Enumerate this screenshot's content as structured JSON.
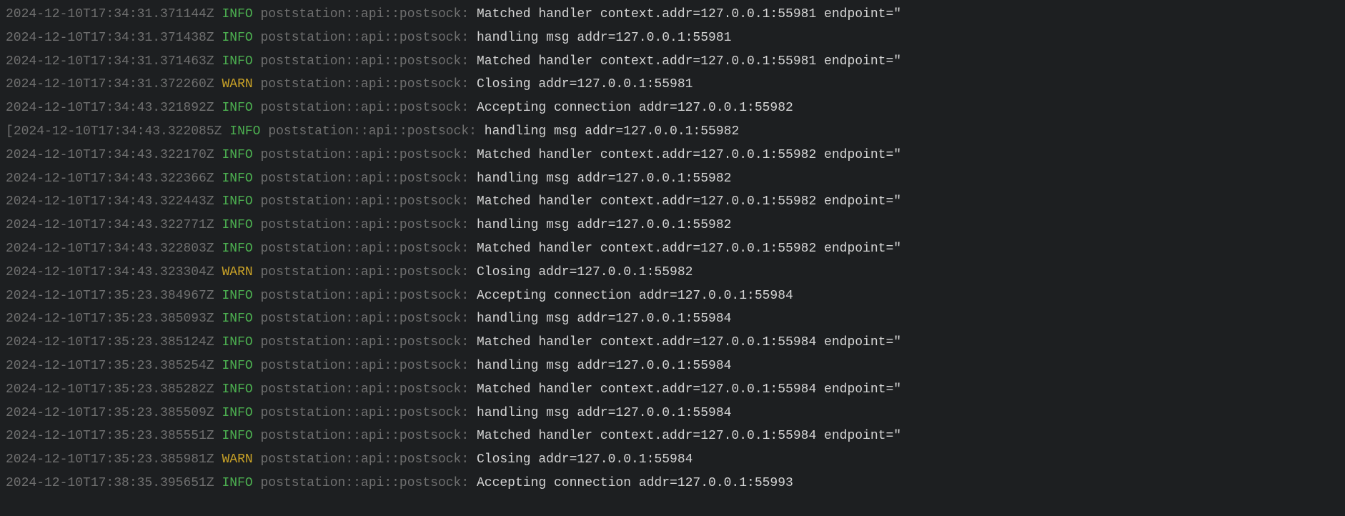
{
  "logs": [
    {
      "prefix": " ",
      "timestamp": "2024-12-10T17:34:31.371144Z",
      "level": "INFO",
      "module": "poststation::api::postsock:",
      "message": "Matched handler context.addr=127.0.0.1:55981 endpoint=\""
    },
    {
      "prefix": " ",
      "timestamp": "2024-12-10T17:34:31.371438Z",
      "level": "INFO",
      "module": "poststation::api::postsock:",
      "message": "handling msg addr=127.0.0.1:55981"
    },
    {
      "prefix": " ",
      "timestamp": "2024-12-10T17:34:31.371463Z",
      "level": "INFO",
      "module": "poststation::api::postsock:",
      "message": "Matched handler context.addr=127.0.0.1:55981 endpoint=\""
    },
    {
      "prefix": " ",
      "timestamp": "2024-12-10T17:34:31.372260Z",
      "level": "WARN",
      "module": "poststation::api::postsock:",
      "message": "Closing addr=127.0.0.1:55981"
    },
    {
      "prefix": " ",
      "timestamp": "2024-12-10T17:34:43.321892Z",
      "level": "INFO",
      "module": "poststation::api::postsock:",
      "message": "Accepting connection addr=127.0.0.1:55982"
    },
    {
      "prefix": "[",
      "timestamp": "2024-12-10T17:34:43.322085Z",
      "level": "INFO",
      "module": "poststation::api::postsock:",
      "message": "handling msg addr=127.0.0.1:55982"
    },
    {
      "prefix": " ",
      "timestamp": "2024-12-10T17:34:43.322170Z",
      "level": "INFO",
      "module": "poststation::api::postsock:",
      "message": "Matched handler context.addr=127.0.0.1:55982 endpoint=\""
    },
    {
      "prefix": " ",
      "timestamp": "2024-12-10T17:34:43.322366Z",
      "level": "INFO",
      "module": "poststation::api::postsock:",
      "message": "handling msg addr=127.0.0.1:55982"
    },
    {
      "prefix": " ",
      "timestamp": "2024-12-10T17:34:43.322443Z",
      "level": "INFO",
      "module": "poststation::api::postsock:",
      "message": "Matched handler context.addr=127.0.0.1:55982 endpoint=\""
    },
    {
      "prefix": " ",
      "timestamp": "2024-12-10T17:34:43.322771Z",
      "level": "INFO",
      "module": "poststation::api::postsock:",
      "message": "handling msg addr=127.0.0.1:55982"
    },
    {
      "prefix": " ",
      "timestamp": "2024-12-10T17:34:43.322803Z",
      "level": "INFO",
      "module": "poststation::api::postsock:",
      "message": "Matched handler context.addr=127.0.0.1:55982 endpoint=\""
    },
    {
      "prefix": " ",
      "timestamp": "2024-12-10T17:34:43.323304Z",
      "level": "WARN",
      "module": "poststation::api::postsock:",
      "message": "Closing addr=127.0.0.1:55982"
    },
    {
      "prefix": " ",
      "timestamp": "2024-12-10T17:35:23.384967Z",
      "level": "INFO",
      "module": "poststation::api::postsock:",
      "message": "Accepting connection addr=127.0.0.1:55984"
    },
    {
      "prefix": " ",
      "timestamp": "2024-12-10T17:35:23.385093Z",
      "level": "INFO",
      "module": "poststation::api::postsock:",
      "message": "handling msg addr=127.0.0.1:55984"
    },
    {
      "prefix": " ",
      "timestamp": "2024-12-10T17:35:23.385124Z",
      "level": "INFO",
      "module": "poststation::api::postsock:",
      "message": "Matched handler context.addr=127.0.0.1:55984 endpoint=\""
    },
    {
      "prefix": " ",
      "timestamp": "2024-12-10T17:35:23.385254Z",
      "level": "INFO",
      "module": "poststation::api::postsock:",
      "message": "handling msg addr=127.0.0.1:55984"
    },
    {
      "prefix": " ",
      "timestamp": "2024-12-10T17:35:23.385282Z",
      "level": "INFO",
      "module": "poststation::api::postsock:",
      "message": "Matched handler context.addr=127.0.0.1:55984 endpoint=\""
    },
    {
      "prefix": " ",
      "timestamp": "2024-12-10T17:35:23.385509Z",
      "level": "INFO",
      "module": "poststation::api::postsock:",
      "message": "handling msg addr=127.0.0.1:55984"
    },
    {
      "prefix": " ",
      "timestamp": "2024-12-10T17:35:23.385551Z",
      "level": "INFO",
      "module": "poststation::api::postsock:",
      "message": "Matched handler context.addr=127.0.0.1:55984 endpoint=\""
    },
    {
      "prefix": " ",
      "timestamp": "2024-12-10T17:35:23.385981Z",
      "level": "WARN",
      "module": "poststation::api::postsock:",
      "message": "Closing addr=127.0.0.1:55984"
    },
    {
      "prefix": " ",
      "timestamp": "2024-12-10T17:38:35.395651Z",
      "level": "INFO",
      "module": "poststation::api::postsock:",
      "message": "Accepting connection addr=127.0.0.1:55993"
    }
  ]
}
